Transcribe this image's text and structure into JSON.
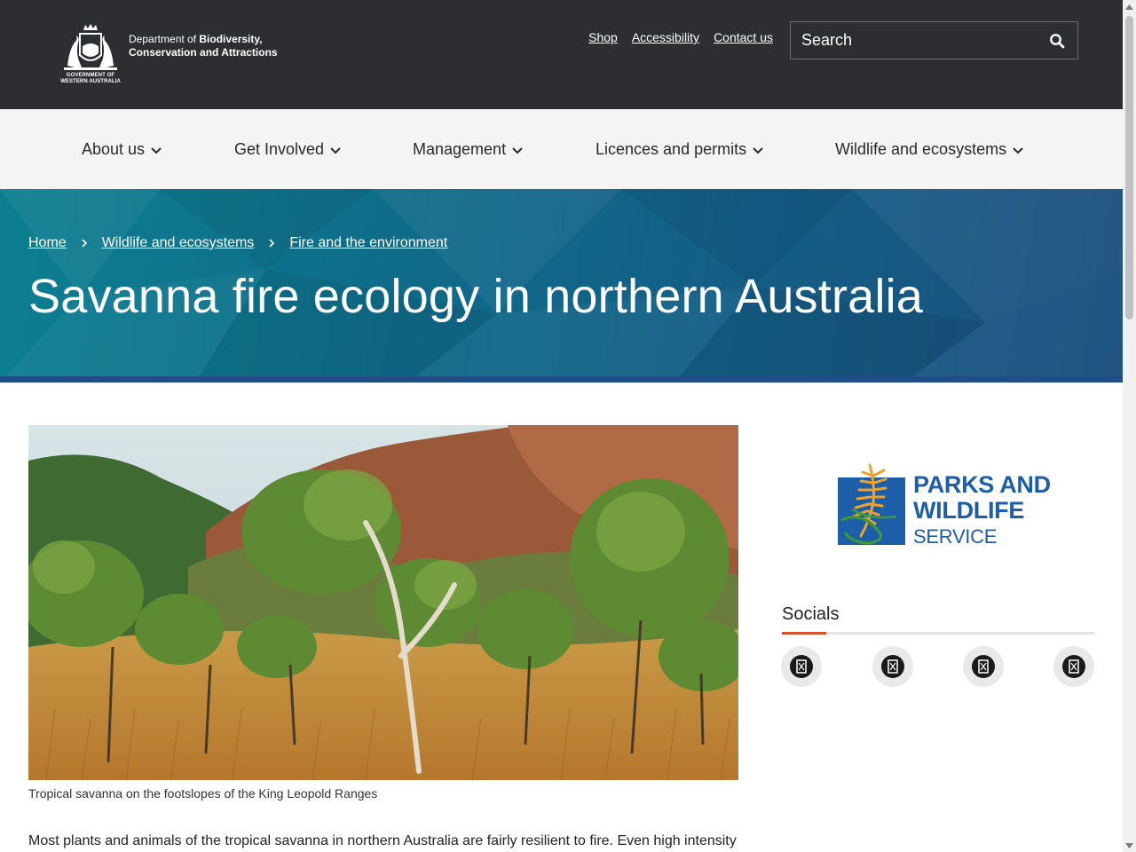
{
  "header": {
    "government_caption": "GOVERNMENT OF WESTERN AUSTRALIA",
    "dept_prefix": "Department of ",
    "dept_bold_1": "Biodiversity,",
    "dept_line_2": "Conservation and Attractions",
    "links": [
      "Shop",
      "Accessibility",
      "Contact us"
    ],
    "search_placeholder": "Search"
  },
  "nav": {
    "items": [
      "About us",
      "Get Involved",
      "Management",
      "Licences and permits",
      "Wildlife and ecosystems"
    ]
  },
  "breadcrumb": [
    "Home",
    "Wildlife and ecosystems",
    "Fire and the environment"
  ],
  "page_title": "Savanna fire ecology in northern Australia",
  "main": {
    "image_caption": "Tropical savanna on the footslopes of the King Leopold Ranges",
    "paragraph": "Most plants and animals of the tropical savanna in northern Australia are fairly resilient to fire. Even high intensity"
  },
  "sidebar": {
    "logo_lines": [
      "PARKS AND",
      "WILDLIFE",
      "SERVICE"
    ],
    "socials_title": "Socials",
    "social_icons": [
      "social-icon-1",
      "social-icon-2",
      "social-icon-3",
      "social-icon-4"
    ]
  },
  "colors": {
    "header_bg": "#2d2e31",
    "nav_bg": "#f4f4f4",
    "hero_start": "#0d7f91",
    "hero_end": "#1a4f7c",
    "pws_blue": "#1c5ea8",
    "accent": "#d9522b"
  }
}
